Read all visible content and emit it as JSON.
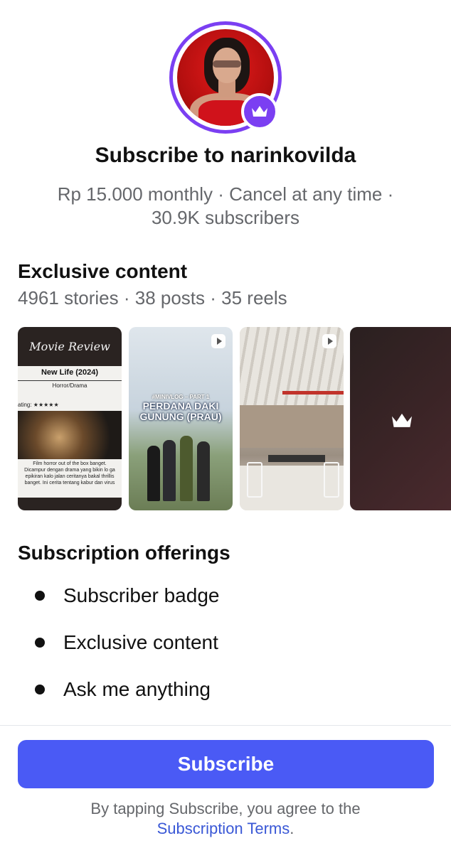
{
  "profile": {
    "username": "narinkovilda",
    "title": "Subscribe to narinkovilda",
    "price_line": "Rp 15.000 monthly · Cancel at any time ·",
    "subscribers_line": "30.9K subscribers"
  },
  "exclusive": {
    "heading": "Exclusive content",
    "counts": "4961 stories · 38 posts · 35 reels",
    "thumb1": {
      "script_title": "Movie Review",
      "movie": "New Life (2024)",
      "genre": "Horror/Drama",
      "rating": "ating: ★★★★★",
      "review_lines": [
        "Film horror out of the box banget.",
        "Dicampur dengan drama yang bikin lo ga",
        "epikiran kalo jalan ceritanya bakal thrillis",
        "banget. Ini cerita tentang kabur dan virus"
      ]
    },
    "thumb2": {
      "vlog": "#MINIVLOG – PART 1",
      "headline_1": "PERDANA DAKI",
      "headline_2": "GUNUNG (PRAU)"
    }
  },
  "offerings": {
    "heading": "Subscription offerings",
    "items": [
      "Subscriber badge",
      "Exclusive content",
      "Ask me anything"
    ]
  },
  "cta": {
    "button": "Subscribe",
    "terms_prefix": "By tapping Subscribe, you agree to the",
    "terms_link": "Subscription Terms",
    "terms_suffix": "."
  },
  "colors": {
    "accent": "#4a5af5",
    "badge": "#7b3ff2",
    "link": "#3a58d6"
  },
  "icons": [
    "crown-icon",
    "play-icon"
  ]
}
